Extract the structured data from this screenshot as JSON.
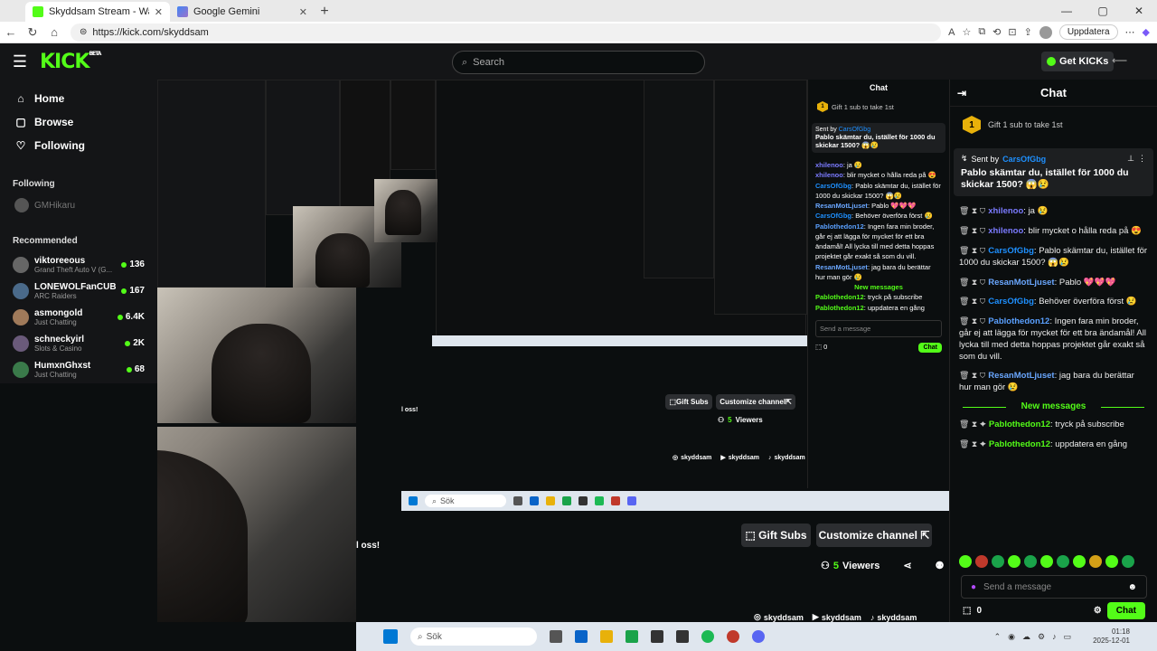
{
  "browser": {
    "tabs": [
      {
        "label": "Skyddsam Stream - Watch Live on Kick",
        "active": true
      },
      {
        "label": "Google Gemini",
        "active": false
      }
    ],
    "url": "https://kick.com/skyddsam",
    "update_label": "Uppdatera"
  },
  "header": {
    "logo": "KICK",
    "logo_sup": "BETA",
    "search_placeholder": "Search",
    "get_kicks": "Get KICKs"
  },
  "sidebar": {
    "nav": [
      {
        "label": "Home",
        "icon": "home-icon"
      },
      {
        "label": "Browse",
        "icon": "browse-icon"
      },
      {
        "label": "Following",
        "icon": "heart-icon"
      }
    ],
    "following_title": "Following",
    "following": [
      {
        "name": "GMHikaru"
      }
    ],
    "recommended_title": "Recommended",
    "recommended": [
      {
        "name": "viktoreeous",
        "game": "Grand Theft Auto V (G...",
        "viewers": "136"
      },
      {
        "name": "LONEWOLFanCUB",
        "game": "ARC Raiders",
        "viewers": "167"
      },
      {
        "name": "asmongold",
        "game": "Just Chatting",
        "viewers": "6.4K"
      },
      {
        "name": "schneckyirl",
        "game": "Slots & Casino",
        "viewers": "2K"
      },
      {
        "name": "HumxnGhxst",
        "game": "Just Chatting",
        "viewers": "68"
      }
    ]
  },
  "stream": {
    "gift_subs": "Gift Subs",
    "customize": "Customize channel",
    "viewers_count": "5",
    "viewers_label": "Viewers",
    "oss": "l oss!",
    "socials": [
      "skyddsam",
      "skyddsam",
      "skyddsam"
    ],
    "taskbar_search": "Sök",
    "clock_time": "01:18",
    "clock_date": "2025-12-01"
  },
  "chat": {
    "title": "Chat",
    "gift_cta": "Gift 1 sub to take 1st",
    "gift_badge": "1",
    "pinned_sent_by": "Sent by",
    "pinned_user": "CarsOfGbg",
    "pinned_message": "Pablo skämtar du, istället för 1000 du skickar 1500? 😱😢",
    "messages": [
      {
        "user": "xhilenoo",
        "color": "#7b7bff",
        "text": "ja 😢"
      },
      {
        "user": "xhilenoo",
        "color": "#7b7bff",
        "text": "blir mycket o hålla reda på 😍"
      },
      {
        "user": "CarsOfGbg",
        "color": "#1e90ff",
        "text": "Pablo skämtar du, istället för 1000 du skickar 1500? 😱😢"
      },
      {
        "user": "ResanMotLjuset",
        "color": "#6aa7ff",
        "text": "Pablo 💖💖💖"
      },
      {
        "user": "CarsOfGbg",
        "color": "#1e90ff",
        "text": "Behöver överföra först 😢"
      },
      {
        "user": "Pablothedon12",
        "color": "#5aa0ff",
        "text": "Ingen fara min broder, går ej att lägga för mycket för ett bra ändamål! All lycka till med detta hoppas projektet går exakt så som du vill."
      },
      {
        "user": "ResanMotLjuset",
        "color": "#6aa7ff",
        "text": "jag bara du berättar hur man gör 😢"
      }
    ],
    "new_messages": "New messages",
    "new": [
      {
        "user": "Pablothedon12",
        "color": "#53fc18",
        "text": "tryck på subscribe"
      },
      {
        "user": "Pablothedon12",
        "color": "#53fc18",
        "text": "uppdatera en gång"
      }
    ],
    "send_placeholder": "Send a message",
    "points": "0",
    "chat_button": "Chat"
  },
  "colors": {
    "accent": "#53fc18",
    "bg": "#0b0e0f",
    "panel": "#141517"
  }
}
